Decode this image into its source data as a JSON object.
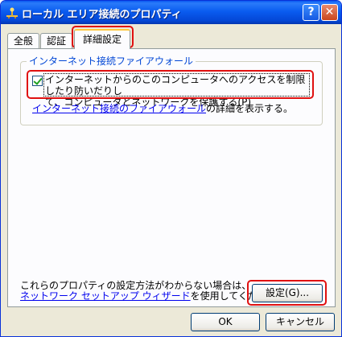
{
  "window": {
    "title": "ローカル エリア接続のプロパティ"
  },
  "titlebar": {
    "help": "?",
    "close": "✕"
  },
  "tabs": [
    "全般",
    "認証",
    "詳細設定"
  ],
  "firewall": {
    "group_title": "インターネット接続ファイアウォール",
    "checkbox_line1": "インターネットからのこのコンピュータへのアクセスを制限したり防いだりし",
    "checkbox_line2": "て、コンピュータとネットワークを保護する(P)",
    "checked": true,
    "link_text": "インターネット接続のファイアウォール",
    "link_suffix": "の詳細を表示する。"
  },
  "help": {
    "line1": "これらのプロパティの設定方法がわからない場合は、",
    "link_text": "ネットワーク セットアップ ウィザード",
    "line2_suffix": "を使用してください。"
  },
  "buttons": {
    "settings": "設定(G)...",
    "ok": "OK",
    "cancel": "キャンセル"
  },
  "colors": {
    "highlight": "#e01010",
    "link": "#0000ee",
    "group_title": "#0046d5"
  }
}
